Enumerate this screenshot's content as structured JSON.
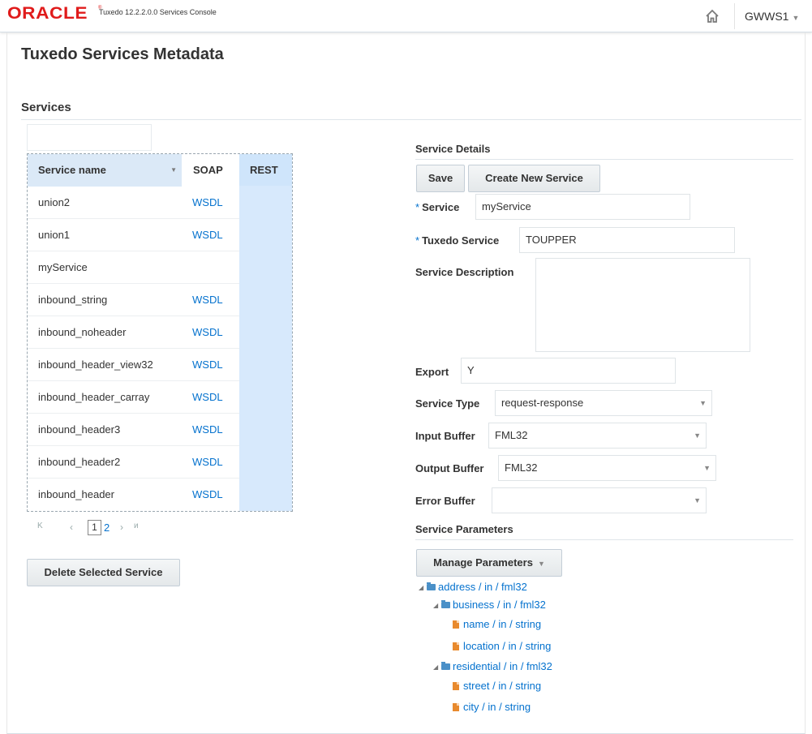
{
  "header": {
    "logo": "ORACLE",
    "app_title": "Tuxedo 12.2.2.0.0 Services Console",
    "user": "GWWS1"
  },
  "page": {
    "title": "Tuxedo Services Metadata",
    "section_title": "Services"
  },
  "table": {
    "columns": [
      "Service name",
      "SOAP",
      "REST"
    ],
    "rows": [
      {
        "name": "union2",
        "soap": "WSDL"
      },
      {
        "name": "union1",
        "soap": "WSDL"
      },
      {
        "name": "myService",
        "soap": ""
      },
      {
        "name": "inbound_string",
        "soap": "WSDL"
      },
      {
        "name": "inbound_noheader",
        "soap": "WSDL"
      },
      {
        "name": "inbound_header_view32",
        "soap": "WSDL"
      },
      {
        "name": "inbound_header_carray",
        "soap": "WSDL"
      },
      {
        "name": "inbound_header3",
        "soap": "WSDL"
      },
      {
        "name": "inbound_header2",
        "soap": "WSDL"
      },
      {
        "name": "inbound_header",
        "soap": "WSDL"
      }
    ]
  },
  "pager": {
    "current": "1",
    "next_page": "2"
  },
  "actions": {
    "delete_label": "Delete Selected Service"
  },
  "details": {
    "title": "Service Details",
    "save_label": "Save",
    "create_label": "Create New Service",
    "service_label": "Service",
    "service_value": "myService",
    "tuxedo_service_label": "Tuxedo Service",
    "tuxedo_service_value": "TOUPPER",
    "description_label": "Service Description",
    "description_value": "",
    "export_label": "Export",
    "export_value": "Y",
    "service_type_label": "Service Type",
    "service_type_value": "request-response",
    "input_buffer_label": "Input Buffer",
    "input_buffer_value": "FML32",
    "output_buffer_label": "Output Buffer",
    "output_buffer_value": "FML32",
    "error_buffer_label": "Error Buffer",
    "error_buffer_value": ""
  },
  "params": {
    "title": "Service Parameters",
    "manage_label": "Manage Parameters",
    "tree": [
      {
        "label": "address / in / fml32",
        "type": "folder"
      },
      {
        "label": "business / in / fml32",
        "type": "folder"
      },
      {
        "label": "name / in / string",
        "type": "file"
      },
      {
        "label": "location / in / string",
        "type": "file"
      },
      {
        "label": "residential / in / fml32",
        "type": "folder"
      },
      {
        "label": "street / in / string",
        "type": "file"
      },
      {
        "label": "city / in / string",
        "type": "file"
      }
    ]
  },
  "colors": {
    "brand_red": "#e01b1b",
    "link_blue": "#0572ce",
    "rest_column": "#d7e9fc",
    "sorted_header": "#dbe9f7"
  }
}
